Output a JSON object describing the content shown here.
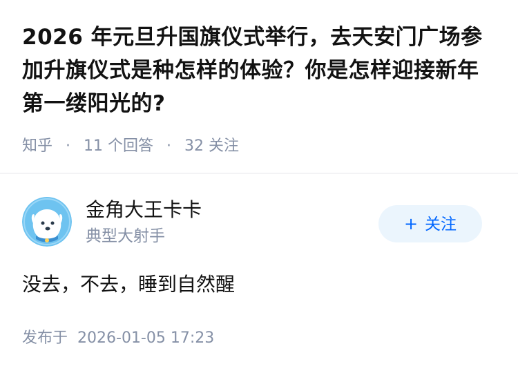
{
  "question": {
    "title": "2026 年元旦升国旗仪式举行，去天安门广场参加升旗仪式是种怎样的体验？你是怎样迎接新年第一缕阳光的?",
    "source": "知乎",
    "answer_count": "11 个回答",
    "follower_count": "32 关注",
    "separator": "·"
  },
  "author": {
    "name": "金角大王卡卡",
    "tagline": "典型大射手",
    "avatar_icon": "dog-avatar-icon",
    "follow_plus": "+",
    "follow_label": "关注"
  },
  "answer": {
    "text": "没去，不去，睡到自然醒",
    "published_label": "发布于",
    "published_time": "2026-01-05 17:23"
  },
  "colors": {
    "primary_text": "#121212",
    "secondary_text": "#8590a6",
    "accent": "#0066ff",
    "follow_bg": "#ebf5fd",
    "avatar_bg": "#6ec3f0"
  }
}
